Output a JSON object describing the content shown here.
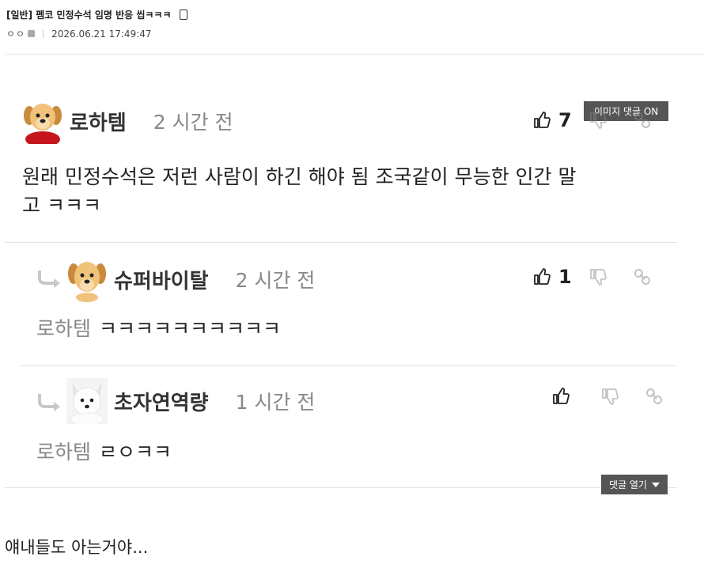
{
  "post": {
    "title": "[일반] 펨코 민정수석 임명 반응 씹ㅋㅋㅋ",
    "author_masked": "ㅇㅇ",
    "datetime": "2026.06.21 17:49:47"
  },
  "image_comment_toggle": "이미지 댓글 ON",
  "comments": [
    {
      "nick": "로하템",
      "time": "2 시간 전",
      "likes": "7",
      "text_line1": "원래 민정수석은 저런 사람이 하긴 해야 됨 조국같이 무능한 인간 말",
      "text_line2": "고 ㅋㅋㅋ"
    },
    {
      "nick": "슈퍼바이탈",
      "time": "2 시간 전",
      "likes": "1",
      "reply_to": "로하템",
      "text": "ㅋㅋㅋㅋㅋㅋㅋㅋㅋㅋ"
    },
    {
      "nick": "초자연역량",
      "time": "1 시간 전",
      "likes": "",
      "reply_to": "로하템",
      "text": "ㄹㅇㅋㅋ"
    }
  ],
  "open_comments_label": "댓글 열기",
  "body_text": "얘내들도 아는거야...",
  "icons": [
    "mobile-icon",
    "thumbs-up-icon",
    "thumbs-down-icon",
    "link-icon",
    "reply-arrow-icon",
    "caret-down-icon"
  ]
}
